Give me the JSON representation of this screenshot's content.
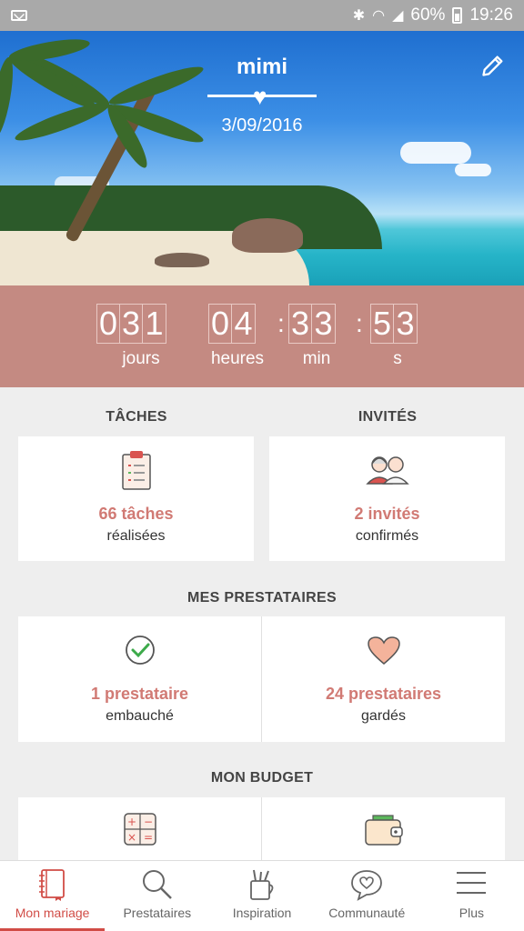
{
  "status_bar": {
    "battery": "60%",
    "time": "19:26"
  },
  "hero": {
    "title": "mimi",
    "date": "3/09/2016"
  },
  "countdown": {
    "days": [
      "0",
      "3",
      "1"
    ],
    "hours": [
      "0",
      "4"
    ],
    "minutes": [
      "3",
      "3"
    ],
    "seconds": [
      "5",
      "3"
    ],
    "sep": ":",
    "labels": {
      "days": "jours",
      "hours": "heures",
      "minutes": "min",
      "seconds": "s"
    }
  },
  "tasks": {
    "title": "TÂCHES",
    "count": "66 tâches",
    "sub": "réalisées"
  },
  "guests": {
    "title": "INVITÉS",
    "count": "2 invités",
    "sub": "confirmés"
  },
  "vendors": {
    "title": "MES PRESTATAIRES",
    "hired": {
      "count": "1 prestataire",
      "sub": "embauché"
    },
    "saved": {
      "count": "24 prestataires",
      "sub": "gardés"
    }
  },
  "budget": {
    "title": "MON BUDGET"
  },
  "nav": [
    {
      "label": "Mon mariage",
      "icon": "notebook-icon",
      "active": true
    },
    {
      "label": "Prestataires",
      "icon": "search-icon"
    },
    {
      "label": "Inspiration",
      "icon": "brush-cup-icon"
    },
    {
      "label": "Communauté",
      "icon": "chat-heart-icon"
    },
    {
      "label": "Plus",
      "icon": "menu-icon"
    }
  ],
  "colors": {
    "accent": "#d14c46",
    "countdown_bg": "#c48a82",
    "card_value": "#d17a74"
  }
}
